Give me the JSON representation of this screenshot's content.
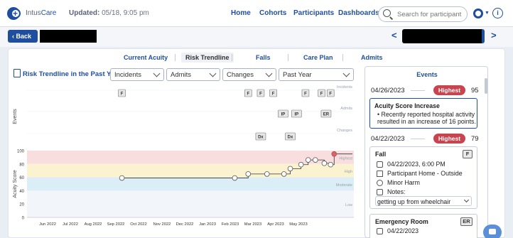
{
  "header": {
    "brand_prefix": "Intus",
    "brand_suffix": "Care",
    "updated_label": "Updated:",
    "updated_value": "05/18, 9:05 pm",
    "nav": [
      "Home",
      "Cohorts",
      "Participants",
      "Dashboards"
    ],
    "search_placeholder": "Search for participant",
    "info_label": "i"
  },
  "subbar": {
    "back_label": "Back",
    "prev_label": "<",
    "next_label": ">"
  },
  "tabs": [
    "Current Acuity",
    "Risk Trendline",
    "Falls",
    "Care Plan",
    "Admits"
  ],
  "active_tab": "Risk Trendline",
  "filters": {
    "title": "Risk Trendline in the Past Year",
    "selects": [
      "Incidents",
      "Admits",
      "Changes",
      "Past Year"
    ]
  },
  "chart_data": {
    "type": "line",
    "ylabel": "Acuity Score",
    "events_label": "Events",
    "x_ticks": [
      "Jun 2022",
      "Jul 2022",
      "Aug 2022",
      "Sep 2022",
      "Oct 2022",
      "Nov 2022",
      "Dec 2022",
      "Jan 2023",
      "Feb 2023",
      "Mar 2023",
      "Apr 2023",
      "May 2023"
    ],
    "y_ticks": [
      0,
      20,
      40,
      60,
      80,
      100
    ],
    "ylim": [
      0,
      100
    ],
    "bands": [
      {
        "name": "Highest",
        "from": 80,
        "to": 100,
        "color": "#f8dede"
      },
      {
        "name": "High",
        "from": 60,
        "to": 80,
        "color": "#fbf3cf"
      },
      {
        "name": "Moderate",
        "from": 40,
        "to": 60,
        "color": "#dbeef7"
      },
      {
        "name": "Low",
        "from": 0,
        "to": 40,
        "color": "#f2f6fa"
      }
    ],
    "event_rows": [
      "Incidents",
      "Admits",
      "Changes"
    ],
    "points": [
      {
        "x": "2022-09-01",
        "y": 59
      },
      {
        "x": "2023-01-05",
        "y": 59
      },
      {
        "x": "2023-01-20",
        "y": 65
      },
      {
        "x": "2023-02-10",
        "y": 65
      },
      {
        "x": "2023-03-01",
        "y": 65
      },
      {
        "x": "2023-03-08",
        "y": 73
      },
      {
        "x": "2023-03-20",
        "y": 79
      },
      {
        "x": "2023-03-28",
        "y": 86
      },
      {
        "x": "2023-04-05",
        "y": 86
      },
      {
        "x": "2023-04-15",
        "y": 81
      },
      {
        "x": "2023-04-22",
        "y": 79
      },
      {
        "x": "2023-04-26",
        "y": 95
      }
    ],
    "markers": [
      {
        "row": "Incidents",
        "label": "F",
        "x": "2022-09-01"
      },
      {
        "row": "Incidents",
        "label": "F",
        "x": "2023-01-20"
      },
      {
        "row": "Incidents",
        "label": "F",
        "x": "2023-02-03"
      },
      {
        "row": "Incidents",
        "label": "F",
        "x": "2023-02-17"
      },
      {
        "row": "Incidents",
        "label": "F",
        "x": "2023-03-25"
      },
      {
        "row": "Incidents",
        "label": "F",
        "x": "2023-04-12"
      },
      {
        "row": "Incidents",
        "label": "F",
        "x": "2023-04-22"
      },
      {
        "row": "Admits",
        "label": "IP",
        "x": "2023-02-28"
      },
      {
        "row": "Admits",
        "label": "IP",
        "x": "2023-03-15"
      },
      {
        "row": "Admits",
        "label": "ER",
        "x": "2023-04-17"
      },
      {
        "row": "Changes",
        "label": "Dx",
        "x": "2023-02-03"
      },
      {
        "row": "Changes",
        "label": "Dx",
        "x": "2023-03-08"
      }
    ]
  },
  "events_panel": {
    "title": "Events",
    "groups": [
      {
        "date": "04/26/2023",
        "badge": "Highest",
        "score": "95",
        "card": {
          "title": "Acuity Score Increase",
          "bullet": "• Recently reported hospital activity resulted in an increase of 16 points."
        }
      },
      {
        "date": "04/22/2023",
        "badge": "Highest",
        "score": "79",
        "card": {
          "title": "Fall",
          "tag": "F",
          "datetime": "04/22/2023, 6:00 PM",
          "location": "Participant Home - Outside",
          "severity": "Minor Harm",
          "notes_label": "Notes:",
          "notes_value": "getting up from wheelchair"
        }
      }
    ],
    "next_card": {
      "title": "Emergency Room",
      "tag": "ER",
      "date_partial": "04/22/2023"
    }
  },
  "colors": {
    "accent": "#1f4e9e",
    "badge": "#c8444f",
    "line": "#333333"
  }
}
